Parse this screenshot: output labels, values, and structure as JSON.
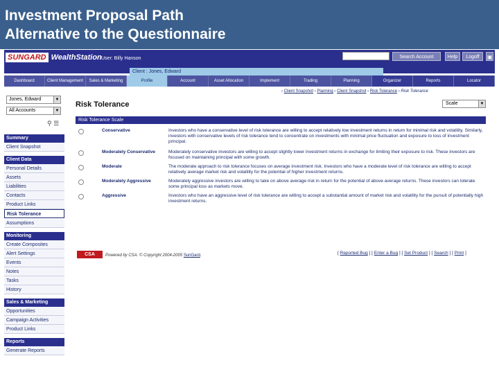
{
  "slide": {
    "title_line1": "Investment Proposal Path",
    "title_line2": "Alternative to the Questionnaire"
  },
  "topbar": {
    "logo_left": "SUNGARD",
    "logo_right": "WealthStation",
    "user": "User: Billy Hanson",
    "search_button": "Search Account",
    "help_button": "Help",
    "logoff_button": "Logoff",
    "client_label": "Client : Jones, Edward"
  },
  "tabs": [
    {
      "label": "Dashboard"
    },
    {
      "label": "Client Management"
    },
    {
      "label": "Sales & Marketing"
    },
    {
      "label": "Profile"
    },
    {
      "label": "Account"
    },
    {
      "label": "Asset Allocation"
    },
    {
      "label": "Implement"
    },
    {
      "label": "Trading"
    },
    {
      "label": "Planning"
    },
    {
      "label": "Organizer"
    },
    {
      "label": "Reports"
    },
    {
      "label": "Locator"
    }
  ],
  "sidebar": {
    "client_select": "Jones, Edward",
    "accounts_select": "All Accounts",
    "sections": [
      {
        "title": "Summary",
        "items": [
          "Client Snapshot"
        ]
      },
      {
        "title": "Client Data",
        "items": [
          "Personal Details",
          "Assets",
          "Liabilities",
          "Contacts",
          "Product Links",
          "Risk Tolerance",
          "Assumptions"
        ]
      },
      {
        "title": "Monitoring",
        "items": [
          "Create Composites",
          "Alert Settings",
          "Events",
          "Notes",
          "Tasks",
          "History"
        ]
      },
      {
        "title": "Sales & Marketing",
        "items": [
          "Opportunities",
          "Campaign Activities",
          "Product Links"
        ]
      },
      {
        "title": "Reports",
        "items": [
          "Generate Reports"
        ]
      }
    ]
  },
  "breadcrumbs": [
    "Client Snapshot",
    "Planning",
    "Client Snapshot",
    "Risk Tolerance",
    "Risk Tolerance"
  ],
  "main": {
    "title": "Risk Tolerance",
    "scale_select": "Scale",
    "table_header": "Risk Tolerance Scale",
    "options": [
      {
        "label": "Conservative",
        "desc": "Investors who have a conservative level of risk tolerance are willing to accept relatively low investment returns in return for minimal risk and volatility. Similarly, investors with conservative levels of risk tolerance tend to concentrate on investments with minimal price fluctuation and exposure to loss of investment principal."
      },
      {
        "label": "Moderately Conservative",
        "desc": "Moderately conservative investors are willing to accept slightly lower investment returns in exchange for limiting their exposure to risk. These investors are focused on maintaining principal with some growth."
      },
      {
        "label": "Moderate",
        "desc": "The moderate approach to risk tolerance focuses on average investment risk. Investors who have a moderate level of risk tolerance are willing to accept relatively average market risk and volatility for the potential of higher investment returns."
      },
      {
        "label": "Moderately Aggressive",
        "desc": "Moderately aggressive investors are willing to take on above average risk in return for the potential of above average returns. These investors can tolerate some principal loss as markets move."
      },
      {
        "label": "Aggressive",
        "desc": "Investors who have an aggressive level of risk tolerance are willing to accept a substantial amount of market risk and volatility for the pursuit of potentially high investment returns."
      }
    ]
  },
  "footer": {
    "logo": "CSA",
    "powered": "Powered by CSA. © Copyright 2004-2005 ",
    "powered_link": "SunGard",
    "links": [
      "Reported Bug",
      "Enter a Bug",
      "Set Product",
      "Search",
      "Print"
    ]
  }
}
